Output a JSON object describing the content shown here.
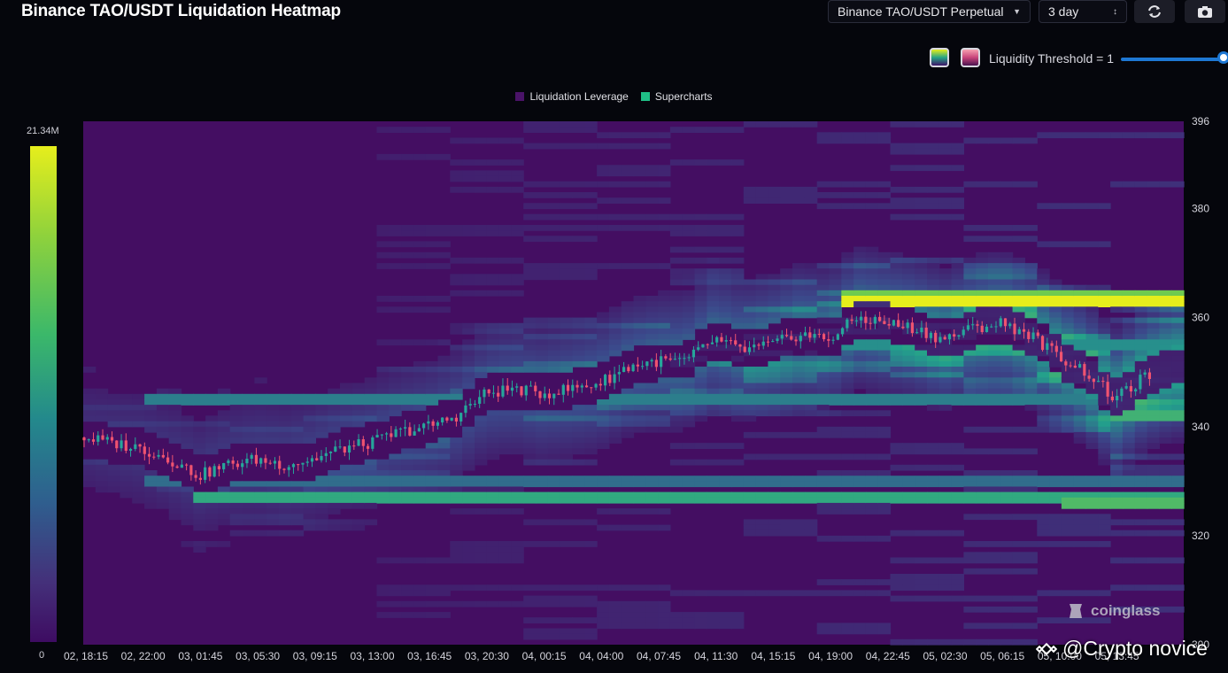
{
  "header": {
    "title": "Binance TAO/USDT Liquidation Heatmap",
    "pair_select": "Binance TAO/USDT Perpetual",
    "range_select": "3 day",
    "refresh_icon": "refresh-icon",
    "camera_icon": "camera-icon"
  },
  "controls": {
    "threshold_label": "Liquidity Threshold = 1",
    "threshold_value": 1,
    "palette_1_icon": "gradient-palette-icon",
    "palette_2_icon": "pink-palette-icon"
  },
  "colors": {
    "background": "#05060c",
    "heat_low": "#440e62",
    "heat_mid": "#22a08c",
    "heat_high": "#e6ee1c",
    "candle_up": "#26a69a",
    "candle_down": "#ef5370",
    "slider": "#1e78d4"
  },
  "watermarks": {
    "brand": "coinglass",
    "attribution": "@Crypto novice"
  },
  "chart_data": {
    "type": "heatmap",
    "title": "Binance TAO/USDT Liquidation Heatmap",
    "legend": [
      "Liquidation Leverage",
      "Supercharts"
    ],
    "legend_placement": "top-center",
    "colorscale": {
      "min_label": "0",
      "max_label": "21.34M"
    },
    "x_ticks": [
      "02, 18:15",
      "02, 22:00",
      "03, 01:45",
      "03, 05:30",
      "03, 09:15",
      "03, 13:00",
      "03, 16:45",
      "03, 20:30",
      "04, 00:15",
      "04, 04:00",
      "04, 07:45",
      "04, 11:30",
      "04, 15:15",
      "04, 19:00",
      "04, 22:45",
      "05, 02:30",
      "05, 06:15",
      "05, 10:00",
      "05, 13:45"
    ],
    "y_ticks": [
      396,
      380,
      360,
      340,
      320,
      300
    ],
    "ylim": [
      300,
      396
    ],
    "grid": false,
    "price_path": [
      [
        0,
        338
      ],
      [
        0.5,
        337
      ],
      [
        1,
        336
      ],
      [
        1.5,
        334
      ],
      [
        2,
        331
      ],
      [
        2.5,
        333
      ],
      [
        3,
        334
      ],
      [
        3.5,
        333
      ],
      [
        4,
        334
      ],
      [
        4.5,
        336
      ],
      [
        5,
        337
      ],
      [
        5.5,
        339
      ],
      [
        6,
        340
      ],
      [
        6.5,
        342
      ],
      [
        7,
        346
      ],
      [
        7.5,
        347
      ],
      [
        8,
        346
      ],
      [
        8.5,
        347
      ],
      [
        9,
        348
      ],
      [
        9.5,
        351
      ],
      [
        10,
        352
      ],
      [
        10.5,
        352
      ],
      [
        11,
        356
      ],
      [
        11.5,
        354
      ],
      [
        12,
        355
      ],
      [
        12.5,
        357
      ],
      [
        13,
        356
      ],
      [
        13.5,
        360
      ],
      [
        14,
        359
      ],
      [
        14.5,
        358
      ],
      [
        15,
        356
      ],
      [
        15.5,
        358
      ],
      [
        16,
        359
      ],
      [
        16.5,
        357
      ],
      [
        17,
        353
      ],
      [
        17.5,
        350
      ],
      [
        18,
        345
      ],
      [
        18.5,
        349
      ],
      [
        19,
        351
      ]
    ],
    "liquidation_bands": [
      {
        "price": 363,
        "from_x": 13.3,
        "intensity": 1.0
      },
      {
        "price": 364,
        "from_x": 13.3,
        "intensity": 0.8
      },
      {
        "price": 342,
        "from_x": 18.0,
        "intensity": 0.65
      },
      {
        "price": 327,
        "from_x": 1.9,
        "intensity": 0.6
      },
      {
        "price": 326,
        "from_x": 17.0,
        "intensity": 0.7
      },
      {
        "price": 355,
        "from_x": 11.6,
        "intensity": 0.5
      },
      {
        "price": 345,
        "from_x": 1.0,
        "intensity": 0.45
      },
      {
        "price": 330,
        "from_x": 1.0,
        "intensity": 0.4
      }
    ]
  }
}
